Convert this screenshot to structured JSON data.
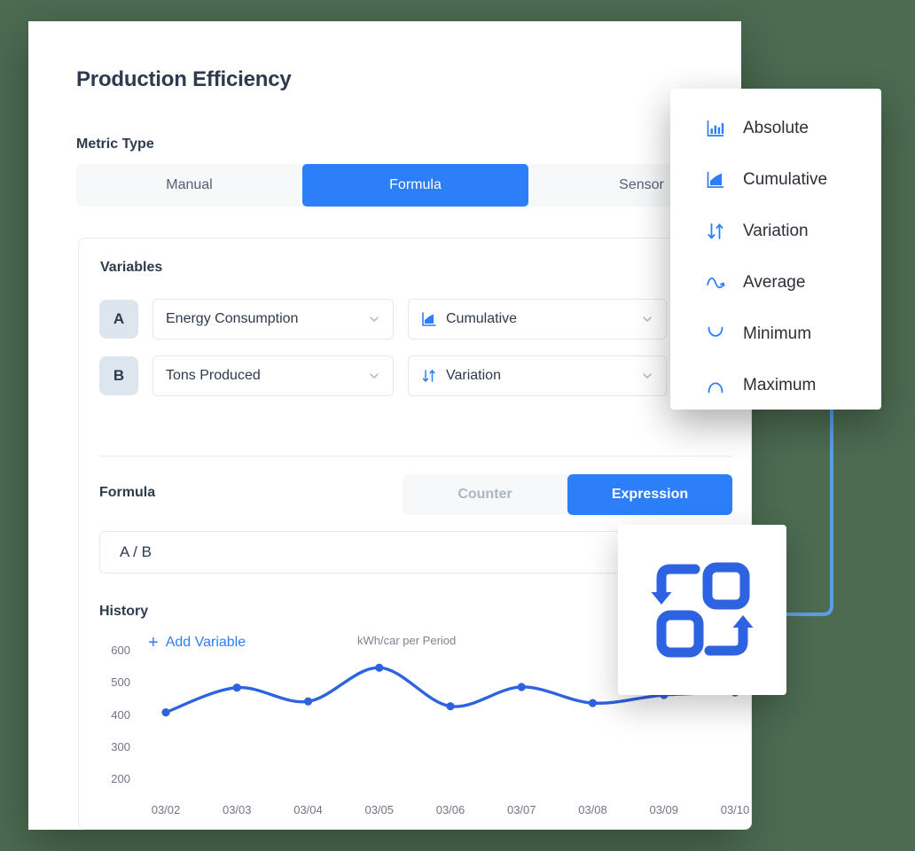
{
  "header": {
    "title": "Production Efficiency"
  },
  "metric_type": {
    "label": "Metric Type",
    "tabs": [
      {
        "label": "Manual",
        "active": false
      },
      {
        "label": "Formula",
        "active": true
      },
      {
        "label": "Sensor",
        "active": false
      }
    ]
  },
  "variables": {
    "title": "Variables",
    "rows": [
      {
        "badge": "A",
        "name": "Energy Consumption",
        "aggregation": "Cumulative",
        "agg_icon": "cumulative-icon",
        "filter_active": false
      },
      {
        "badge": "B",
        "name": "Tons Produced",
        "aggregation": "Variation",
        "agg_icon": "variation-icon",
        "filter_active": true
      }
    ],
    "add_label": "Add Variable"
  },
  "formula": {
    "label": "Formula",
    "modes": [
      {
        "label": "Counter",
        "active": false
      },
      {
        "label": "Expression",
        "active": true
      }
    ],
    "expression": "A / B"
  },
  "history": {
    "title": "History"
  },
  "dropdown": {
    "items": [
      {
        "label": "Absolute",
        "icon": "bar-chart-icon"
      },
      {
        "label": "Cumulative",
        "icon": "area-chart-icon"
      },
      {
        "label": "Variation",
        "icon": "arrows-updown-icon"
      },
      {
        "label": "Average",
        "icon": "wave-icon"
      },
      {
        "label": "Minimum",
        "icon": "valley-curve-icon"
      },
      {
        "label": "Maximum",
        "icon": "peak-curve-icon"
      }
    ]
  },
  "icon_card": {
    "icon": "transform-exchange-icon"
  },
  "colors": {
    "accent": "#2d7ff9",
    "background": "#4c6b51",
    "text_dark": "#2e3b4e",
    "text_muted": "#6f7684",
    "badge_bg": "#dde5ee",
    "connector": "#5b9fe3"
  },
  "chart_data": {
    "type": "line",
    "title": "History",
    "subtitle": "kWh/car per Period",
    "xlabel": "",
    "ylabel": "",
    "categories": [
      "03/02",
      "03/03",
      "03/04",
      "03/05",
      "03/06",
      "03/07",
      "03/08",
      "03/09",
      "03/10"
    ],
    "values": [
      408,
      485,
      442,
      547,
      427,
      487,
      437,
      462,
      470
    ],
    "yticks": [
      600,
      500,
      400,
      300,
      200
    ],
    "ylim": [
      160,
      620
    ],
    "grid": false,
    "legend": false,
    "series_color": "#2d62e0",
    "markers": true
  }
}
